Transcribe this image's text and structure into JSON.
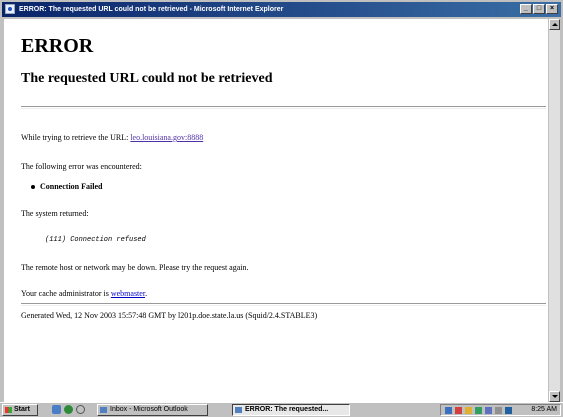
{
  "window": {
    "title": "ERROR: The requested URL could not be retrieved - Microsoft Internet Explorer",
    "controls": {
      "minimize": "_",
      "maximize": "□",
      "close": "×"
    }
  },
  "page": {
    "heading": "ERROR",
    "subheading": "The requested URL could not be retrieved",
    "retrieve_prefix": "While trying to retrieve the URL: ",
    "retrieve_url": "leo.louisiana.gov:8888",
    "error_intro": "The following error was encountered:",
    "error_item": "Connection Failed",
    "system_returned": "The system returned:",
    "system_message": "(111) Connection refused",
    "remote_host_note": "The remote host or network may be down. Please try the request again.",
    "admin_prefix": "Your cache administrator is ",
    "admin_link": "webmaster",
    "admin_suffix": ".",
    "footer": "Generated Wed, 12 Nov 2003 15:57:48 GMT by l201p.doe.state.la.us (Squid/2.4.STABLE3)"
  },
  "taskbar": {
    "start_label": "Start",
    "tasks": [
      {
        "label": "Inbox - Microsoft Outlook"
      },
      {
        "label": "ERROR: The requested..."
      }
    ],
    "clock": "8:25 AM"
  }
}
